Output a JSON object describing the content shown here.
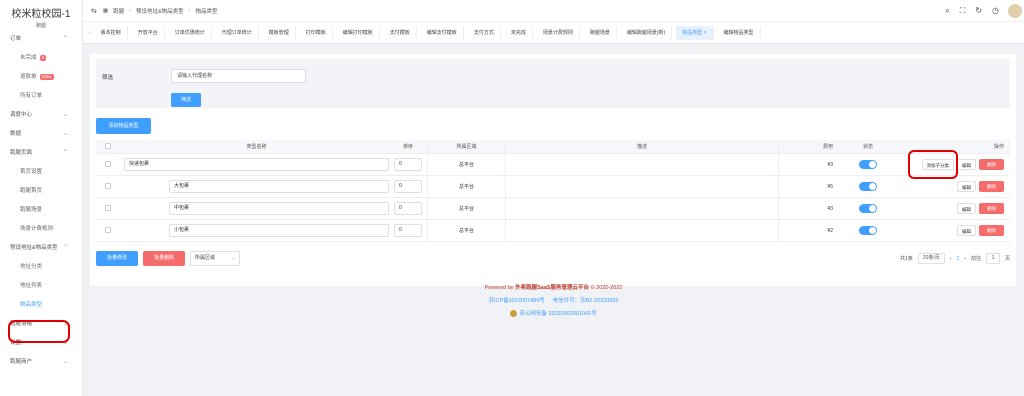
{
  "sidebar": {
    "title": "校米粒校园-1",
    "subtitle": "跑腿",
    "items": [
      {
        "label": "订单",
        "type": "group",
        "arrow": "⌃"
      },
      {
        "label": "未完成",
        "type": "child",
        "badge": "3"
      },
      {
        "label": "退款单",
        "type": "child",
        "badge": "4364"
      },
      {
        "label": "所有订单",
        "type": "child"
      },
      {
        "label": "调度中心",
        "type": "group",
        "arrow": "⌄"
      },
      {
        "label": "数据",
        "type": "group",
        "arrow": "⌄"
      },
      {
        "label": "跑腿页面",
        "type": "group",
        "arrow": "⌃"
      },
      {
        "label": "首页设置",
        "type": "child"
      },
      {
        "label": "跑腿首页",
        "type": "child"
      },
      {
        "label": "跑腿场景",
        "type": "child"
      },
      {
        "label": "场景计费规则",
        "type": "child"
      },
      {
        "label": "预设地址&物品类型",
        "type": "group",
        "arrow": "⌃"
      },
      {
        "label": "地址分类",
        "type": "child"
      },
      {
        "label": "地址列表",
        "type": "child"
      },
      {
        "label": "物品类型",
        "type": "child",
        "active": true
      },
      {
        "label": "跑腿落略",
        "type": "group",
        "arrow": "⌄"
      },
      {
        "label": "设置",
        "type": "group",
        "arrow": "⌄"
      },
      {
        "label": "跑腿商户",
        "type": "group",
        "arrow": "⌄"
      }
    ]
  },
  "header": {
    "crumbs": [
      "跑腿",
      "预设地址&物品类型",
      "物品类型"
    ]
  },
  "tabs": [
    {
      "label": "版本控制"
    },
    {
      "label": "开放平台"
    },
    {
      "label": "订单优惠统计"
    },
    {
      "label": "代理订单统计"
    },
    {
      "label": "模板管理"
    },
    {
      "label": "打印模板"
    },
    {
      "label": "编辑打印模板"
    },
    {
      "label": "支付模板"
    },
    {
      "label": "编辑支付模板"
    },
    {
      "label": "支付方式"
    },
    {
      "label": "未完成"
    },
    {
      "label": "场景计费规则"
    },
    {
      "label": "跑腿场景"
    },
    {
      "label": "编辑跑腿场景(新)"
    },
    {
      "label": "物品类型",
      "active": true
    },
    {
      "label": "编辑物品类型"
    }
  ],
  "filter": {
    "label": "筛选",
    "input_value": "请输入代理名称",
    "button": "筛选"
  },
  "add_button": "添加物品类型",
  "table": {
    "headers": [
      "类型名称",
      "排序",
      "所属区域",
      "描述",
      "费用",
      "状态",
      "操作"
    ],
    "rows": [
      {
        "name": "快递包裹",
        "order": "0",
        "area": "总平台",
        "desc": "",
        "fee": "¥3",
        "sub": false,
        "ops": [
          "添加子分类",
          "编辑",
          "删除"
        ]
      },
      {
        "name": "大包裹",
        "order": "0",
        "area": "总平台",
        "desc": "",
        "fee": "¥5",
        "sub": true,
        "ops": [
          "编辑",
          "删除"
        ]
      },
      {
        "name": "中包裹",
        "order": "0",
        "area": "总平台",
        "desc": "",
        "fee": "¥3",
        "sub": true,
        "ops": [
          "编辑",
          "删除"
        ]
      },
      {
        "name": "小包裹",
        "order": "0",
        "area": "总平台",
        "desc": "",
        "fee": "¥2",
        "sub": true,
        "ops": [
          "编辑",
          "删除"
        ]
      }
    ]
  },
  "bulk": {
    "edit": "批量修改",
    "delete": "批量删除",
    "area_select": "所属区域"
  },
  "pager": {
    "total": "共1条",
    "page_size": "20条/页",
    "page": "1",
    "goto_label": "前往",
    "goto_value": "1",
    "page_suffix": "页"
  },
  "footer": {
    "line1_prefix": "Powered by",
    "line1_brand": "外卖跑腿SaaS服务管理云平台",
    "line1_suffix": "© 2020-2022",
    "icp": "苏ICP备2022007489号",
    "license": "电信许可：苏B2-20220559",
    "police": "苏公网安备 32030302001041号"
  },
  "colors": {
    "primary": "#409eff",
    "danger": "#f56c6c",
    "highlight": "#e00000"
  }
}
